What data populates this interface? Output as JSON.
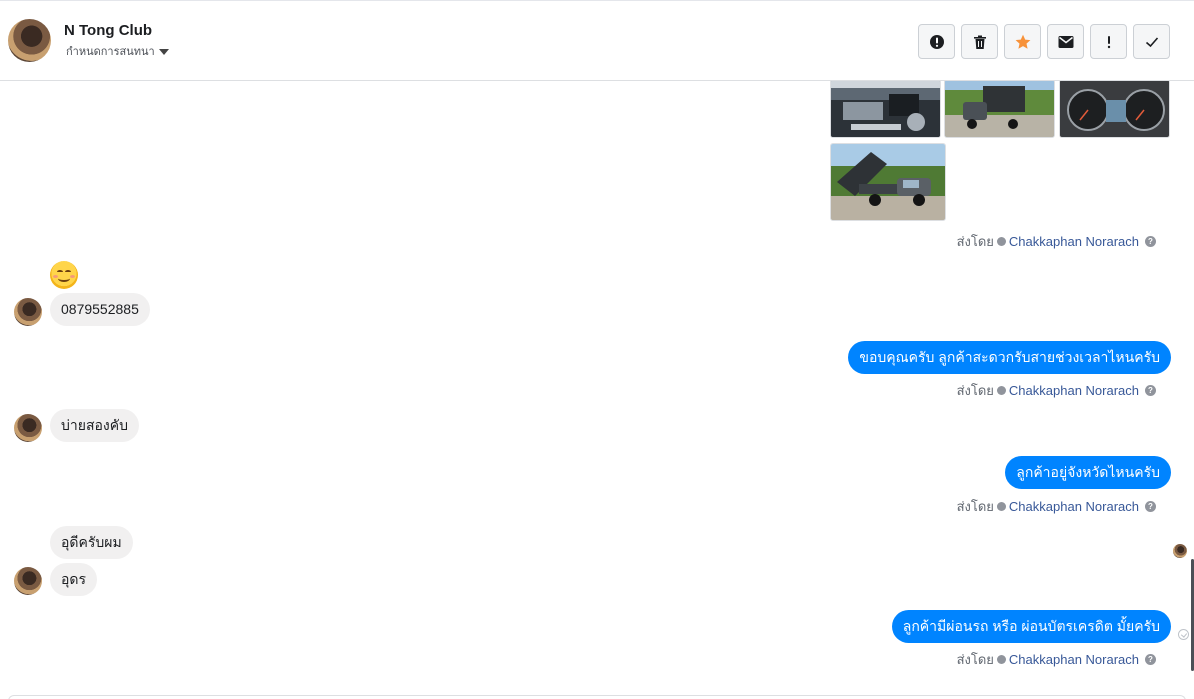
{
  "header": {
    "title": "N Tong Club",
    "subtitle": "กำหนดการสนทนา"
  },
  "toolbar": [
    {
      "name": "report-icon"
    },
    {
      "name": "trash-icon"
    },
    {
      "name": "star-icon"
    },
    {
      "name": "mail-icon"
    },
    {
      "name": "exclamation-icon"
    },
    {
      "name": "checkmark-icon"
    }
  ],
  "colors": {
    "accent": "#0084ff",
    "star": "#f7923a",
    "link": "#385898"
  },
  "messages": {
    "sent_by_label": "ส่งโดย",
    "sender_name": "Chakkaphan Norarach",
    "help_glyph": "?",
    "incoming": {
      "phone": "0879552885",
      "afternoon": "บ่ายสองคับ",
      "udon_full": "อุดีครับผม",
      "udon": "อุดร"
    },
    "outgoing": {
      "thanks": "ขอบคุณครับ ลูกค้าสะดวกรับสายช่วงเวลาไหนครับ",
      "province": "ลูกค้าอยู่จังหวัดไหนครับ",
      "finance": "ลูกค้ามีผ่อนรถ หรือ ผ่อนบัตรเครดิต มั้ยครับ"
    }
  }
}
